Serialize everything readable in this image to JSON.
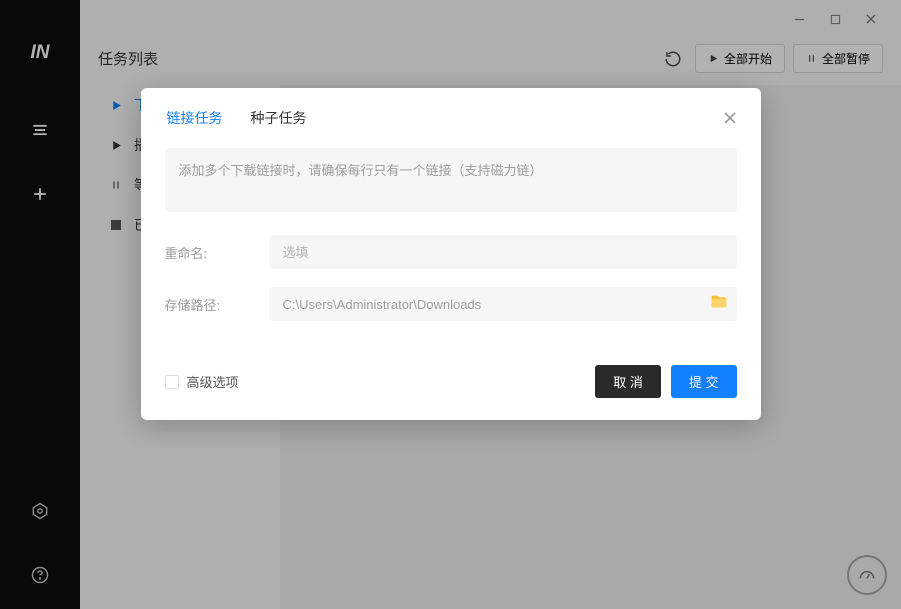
{
  "sidebar": {
    "logo": "IN"
  },
  "page": {
    "title": "任务列表"
  },
  "topbar": {
    "start_all_label": "全部开始",
    "pause_all_label": "全部暂停"
  },
  "filters": {
    "items": [
      {
        "label": "下"
      },
      {
        "label": "播"
      },
      {
        "label": "等"
      },
      {
        "label": "已"
      }
    ]
  },
  "modal": {
    "tabs": {
      "link": "链接任务",
      "seed": "种子任务"
    },
    "link_placeholder": "添加多个下载链接时，请确保每行只有一个链接（支持磁力链）",
    "rename_label": "重命名:",
    "rename_placeholder": "选填",
    "rename_value": "",
    "path_label": "存储路径:",
    "path_value": "C:\\Users\\Administrator\\Downloads",
    "advanced_label": "高级选项",
    "cancel_label": "取 消",
    "submit_label": "提 交"
  }
}
